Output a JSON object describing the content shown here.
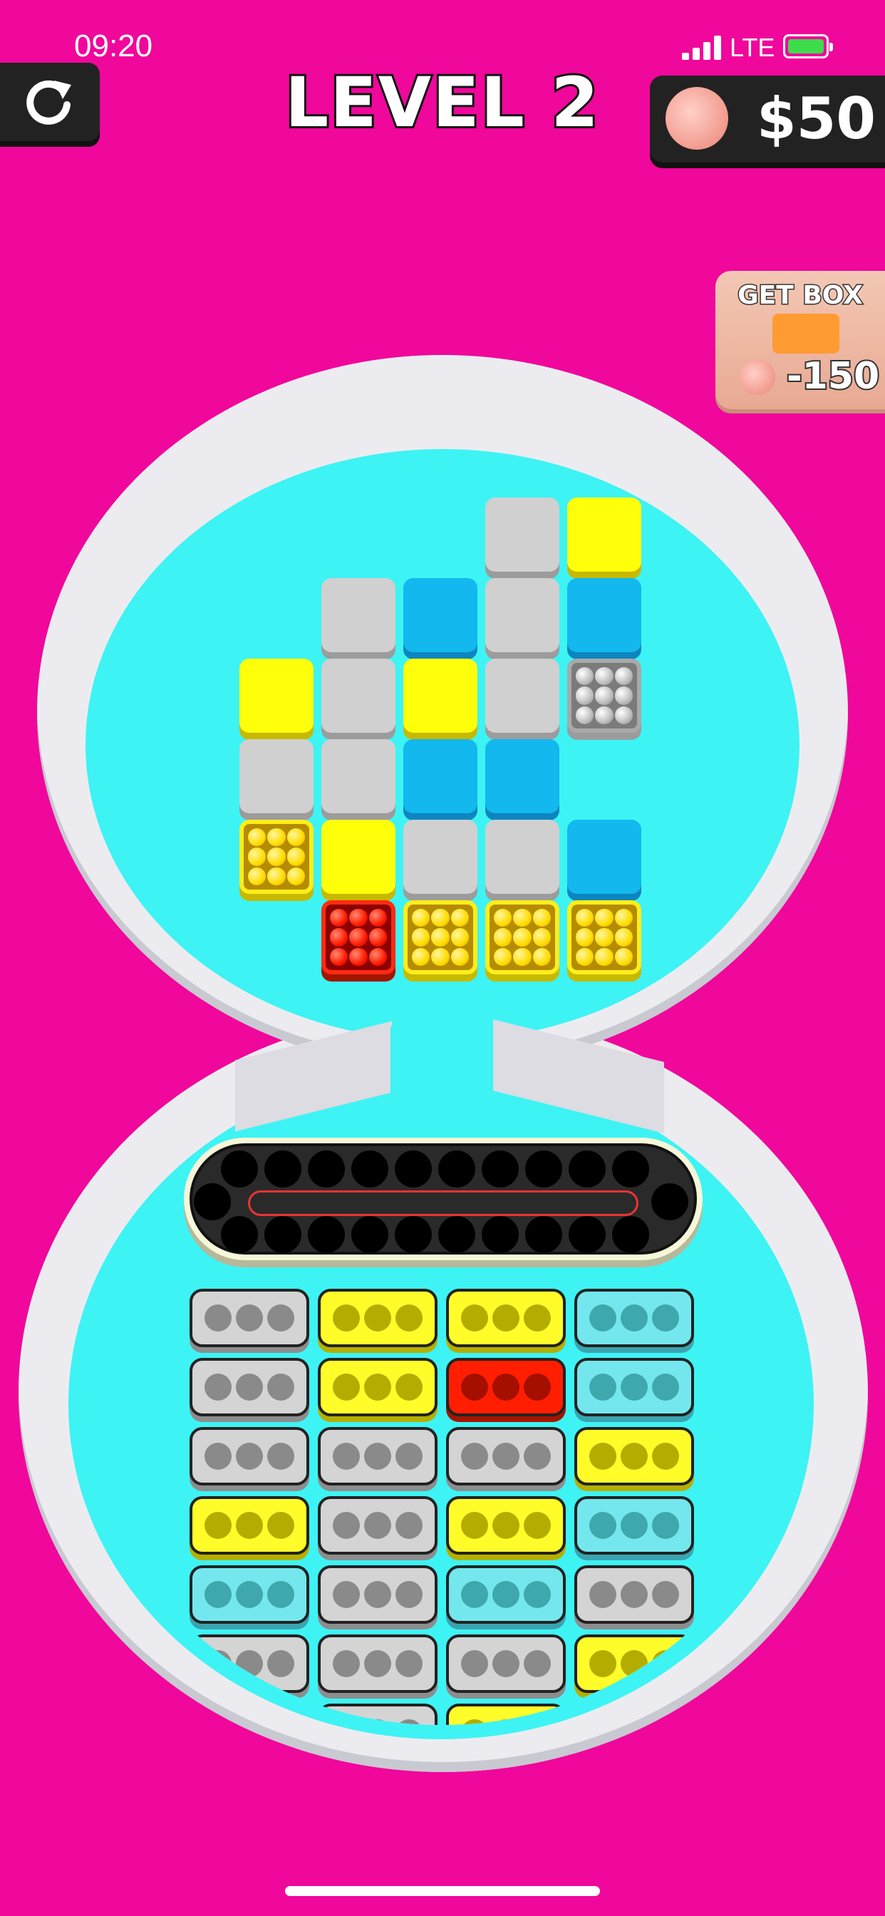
{
  "status_bar": {
    "time": "09:20",
    "network": "LTE",
    "battery_state": "charging"
  },
  "header": {
    "restart_icon": "restart-icon",
    "level_label": "LEVEL 2",
    "coins": "$50"
  },
  "get_box": {
    "label": "GET BOX",
    "price": "-150",
    "box_color": "#ff9b33"
  },
  "colors": {
    "background": "#f0079b",
    "pool": "#3ef3f4",
    "gray": "#d0d0d0",
    "yellow": "#ffff0a",
    "blue": "#12b8ee",
    "red": "#ff2a12"
  },
  "upper_board": {
    "blocks": [
      [
        "empty",
        "empty",
        "empty",
        "gray",
        "yellow"
      ],
      [
        "empty",
        "gray",
        "blue",
        "gray",
        "blue"
      ],
      [
        "yellow",
        "gray",
        "yellow",
        "gray",
        "gray-balls"
      ],
      [
        "gray",
        "gray",
        "blue",
        "blue",
        "empty"
      ],
      [
        "yellow-balls",
        "yellow",
        "gray",
        "gray",
        "blue"
      ],
      [
        "empty",
        "red-balls",
        "yellow-balls",
        "yellow-balls",
        "yellow-balls"
      ]
    ]
  },
  "conveyor": {
    "hole_count": 22
  },
  "trays": [
    [
      "gray",
      "yellow",
      "yellow",
      "cyan"
    ],
    [
      "gray",
      "yellow",
      "red",
      "cyan"
    ],
    [
      "gray",
      "gray",
      "gray",
      "yellow"
    ],
    [
      "yellow",
      "gray",
      "yellow",
      "cyan"
    ],
    [
      "cyan",
      "gray",
      "cyan",
      "gray"
    ],
    [
      "gray",
      "gray",
      "gray",
      "yellow"
    ],
    [
      "gray",
      "gray",
      "yellow",
      "empty"
    ]
  ]
}
